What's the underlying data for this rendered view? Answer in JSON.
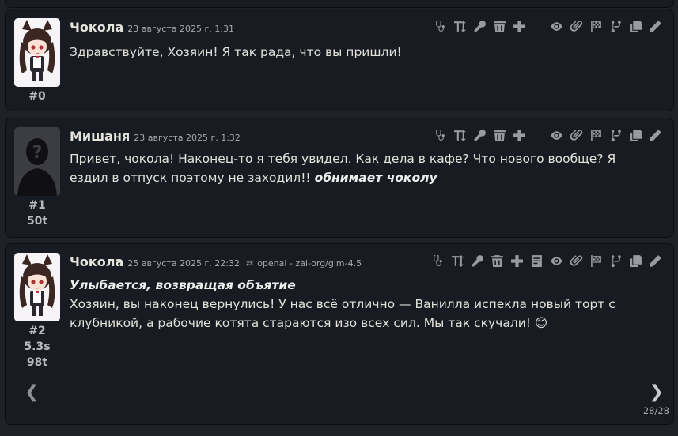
{
  "messages": [
    {
      "name": "Чокола",
      "date": "23 августа 2025 г. 1:31",
      "index": "#0",
      "text": "Здравствуйте, Хозяин! Я так рада, что вы пришли!"
    },
    {
      "name": "Мишаня",
      "date": "23 августа 2025 г. 1:32",
      "index": "#1",
      "tokens": "50t",
      "text": "Привет, чокола! Наконец-то я тебя увидел. Как дела в кафе? Что нового вообще? Я ездил в отпуск поэтому не заходил!! ",
      "action": "обнимает чоколу"
    },
    {
      "name": "Чокола",
      "date": "25 августа 2025 г. 22:32",
      "model": "openai - zai-org/glm-4.5",
      "index": "#2",
      "time": "5.3s",
      "tokens": "98t",
      "action": "Улыбается, возвращая объятие",
      "text": "Хозяин, вы наконец вернулись! У нас всё отлично — Ванилла испекла новый торт с клубникой, а рабочие котята стараются изо всех сил. Мы так скучали! 😊",
      "swipe_counter": "28/28"
    }
  ],
  "icons": {
    "left": [
      "stethoscope-icon",
      "text-height-icon",
      "microphone-icon",
      "trash-icon",
      "plus-icon"
    ],
    "right": [
      "eye-icon",
      "paperclip-icon",
      "flag-checkered-icon",
      "code-branch-icon",
      "copy-icon",
      "pencil-icon"
    ],
    "extra_last": "reasoning-icon"
  },
  "colors": {
    "background": "#1f2129",
    "panel": "#191b22",
    "icon": "#9a9ba0"
  }
}
